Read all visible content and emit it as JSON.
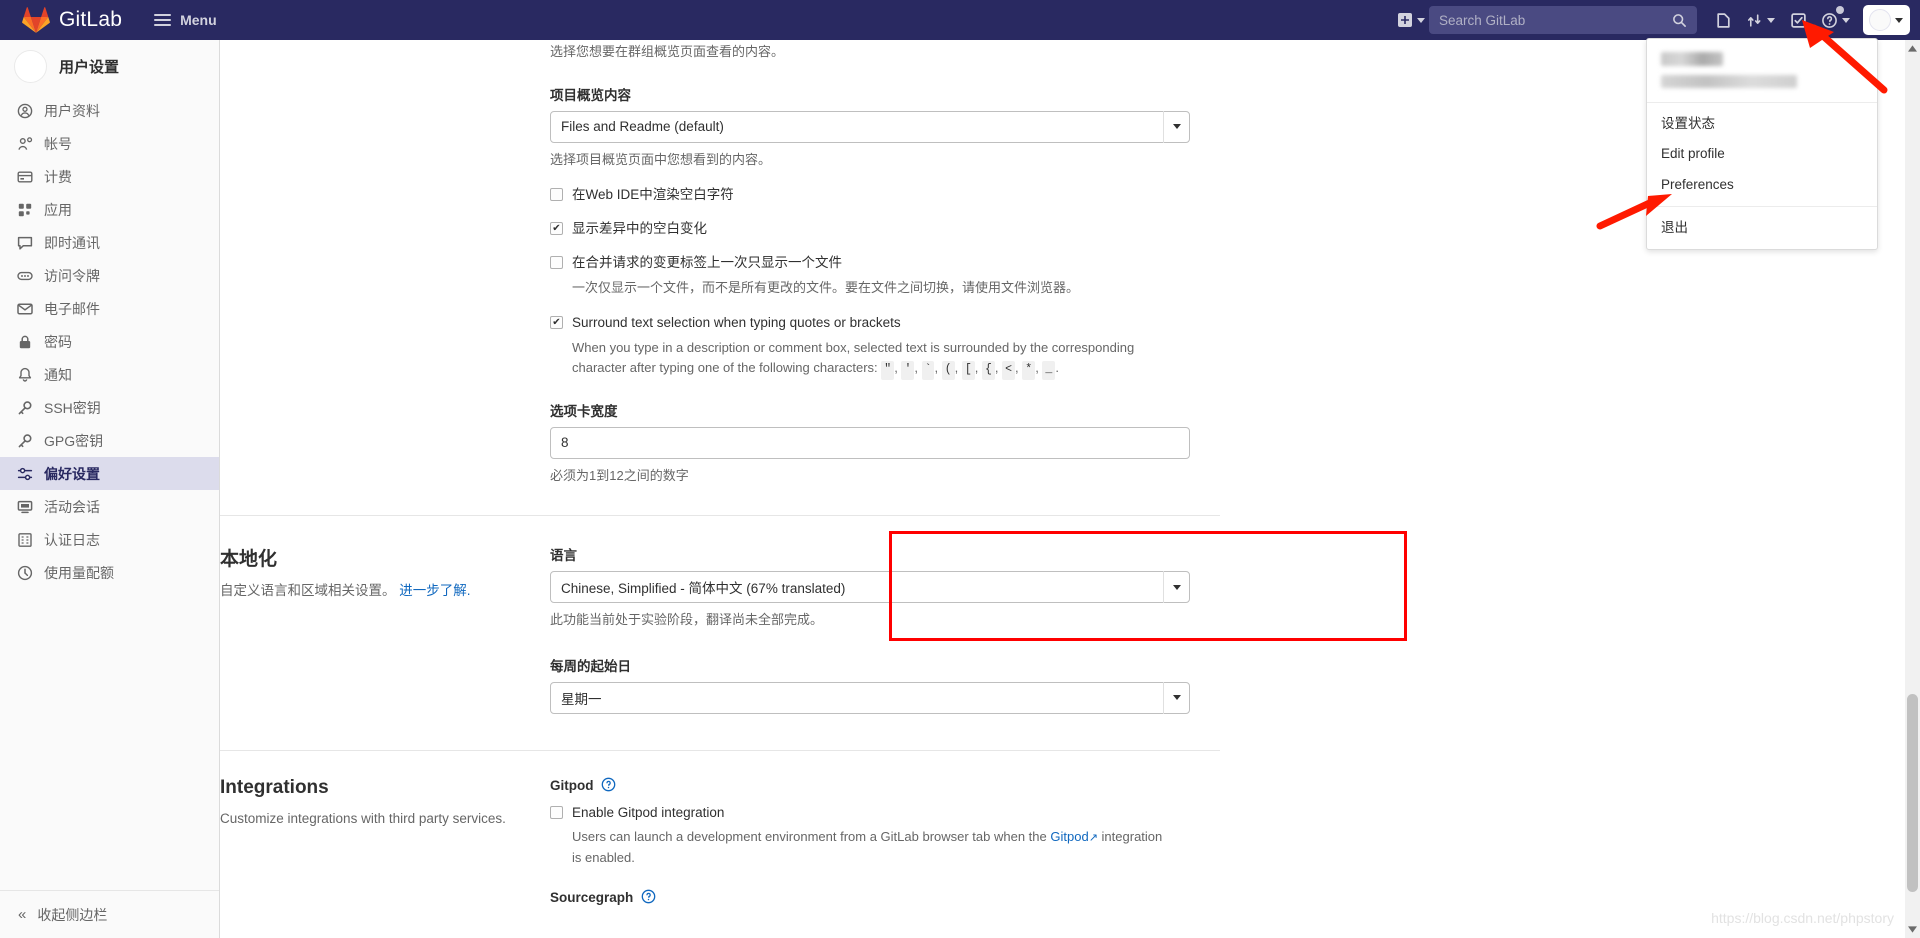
{
  "navbar": {
    "brand": "GitLab",
    "menu_label": "Menu",
    "search_placeholder": "Search GitLab",
    "icons": {
      "plus": "plus-square-icon",
      "search": "search-icon",
      "issues": "issues-icon",
      "merge_requests": "merge-request-icon",
      "todos": "todo-checkmark-icon",
      "help": "help-question-icon",
      "avatar": "user-avatar-icon"
    }
  },
  "user_dropdown": {
    "visible": true,
    "username_redacted": true,
    "email_redacted": true,
    "items": [
      {
        "label": "设置状态",
        "group": 1
      },
      {
        "label": "Edit profile",
        "group": 1
      },
      {
        "label": "Preferences",
        "group": 1
      },
      {
        "label": "退出",
        "group": 2
      }
    ]
  },
  "sidebar": {
    "title": "用户设置",
    "collapse_label": "收起侧边栏",
    "items": [
      {
        "label": "用户资料",
        "icon": "profile-icon",
        "active": false
      },
      {
        "label": "帐号",
        "icon": "account-icon",
        "active": false
      },
      {
        "label": "计费",
        "icon": "credit-card-icon",
        "active": false
      },
      {
        "label": "应用",
        "icon": "applications-grid-icon",
        "active": false
      },
      {
        "label": "即时通讯",
        "icon": "chat-icon",
        "active": false
      },
      {
        "label": "访问令牌",
        "icon": "token-icon",
        "active": false
      },
      {
        "label": "电子邮件",
        "icon": "envelope-icon",
        "active": false
      },
      {
        "label": "密码",
        "icon": "lock-icon",
        "active": false
      },
      {
        "label": "通知",
        "icon": "bell-icon",
        "active": false
      },
      {
        "label": "SSH密钥",
        "icon": "key-icon",
        "active": false
      },
      {
        "label": "GPG密钥",
        "icon": "key-icon",
        "active": false
      },
      {
        "label": "偏好设置",
        "icon": "preferences-sliders-icon",
        "active": true
      },
      {
        "label": "活动会话",
        "icon": "monitor-icon",
        "active": false
      },
      {
        "label": "认证日志",
        "icon": "log-list-icon",
        "active": false
      },
      {
        "label": "使用量配额",
        "icon": "quota-gauge-icon",
        "active": false
      }
    ]
  },
  "behavior": {
    "group_overview_help": "选择您想要在群组概览页面查看的内容。",
    "project_overview_label": "项目概览内容",
    "project_overview_value": "Files and Readme (default)",
    "project_overview_help": "选择项目概览页面中您想看到的内容。",
    "checkbox_render_whitespace": "在Web IDE中渲染空白字符",
    "checkbox_show_whitespace_diff": "显示差异中的空白变化",
    "checkbox_single_file_mr": "在合并请求的变更标签上一次只显示一个文件",
    "single_file_mr_help": "一次仅显示一个文件，而不是所有更改的文件。要在文件之间切换，请使用文件浏览器。",
    "checkbox_surround_selection": "Surround text selection when typing quotes or brackets",
    "surround_selection_help_1": "When you type in a description or comment box, selected text is surrounded by the corresponding",
    "surround_selection_help_2": "character after typing one of the following characters:",
    "surround_chars": [
      "\"",
      "'",
      "`",
      "(",
      "[",
      "{",
      "<",
      "*",
      "_"
    ],
    "tab_width_label": "选项卡宽度",
    "tab_width_value": "8",
    "tab_width_help": "必须为1到12之间的数字"
  },
  "localization": {
    "title": "本地化",
    "desc": "自定义语言和区域相关设置。",
    "desc_link": "进一步了解.",
    "language_label": "语言",
    "language_value": "Chinese, Simplified - 简体中文 (67% translated)",
    "language_help": "此功能当前处于实验阶段，翻译尚未全部完成。",
    "first_day_label": "每周的起始日",
    "first_day_value": "星期一"
  },
  "integrations": {
    "title": "Integrations",
    "desc": "Customize integrations with third party services.",
    "gitpod_label": "Gitpod",
    "gitpod_checkbox": "Enable Gitpod integration",
    "gitpod_help_1": "Users can launch a development environment from a GitLab browser tab when the",
    "gitpod_help_link": "Gitpod",
    "gitpod_help_2": "integration is enabled.",
    "sourcegraph_label": "Sourcegraph"
  },
  "annotations": {
    "highlight_color": "#ff0000",
    "highlight_target": "语言",
    "arrow_targets": [
      "avatar-dropdown-toggle",
      "Preferences"
    ]
  },
  "watermark": "https://blog.csdn.net/phpstory",
  "colors": {
    "navbar_bg": "#292961",
    "sidebar_bg": "#fafafa",
    "active_item_bg": "#dcdcec",
    "link": "#1068bf",
    "annotation": "#ff0000"
  }
}
